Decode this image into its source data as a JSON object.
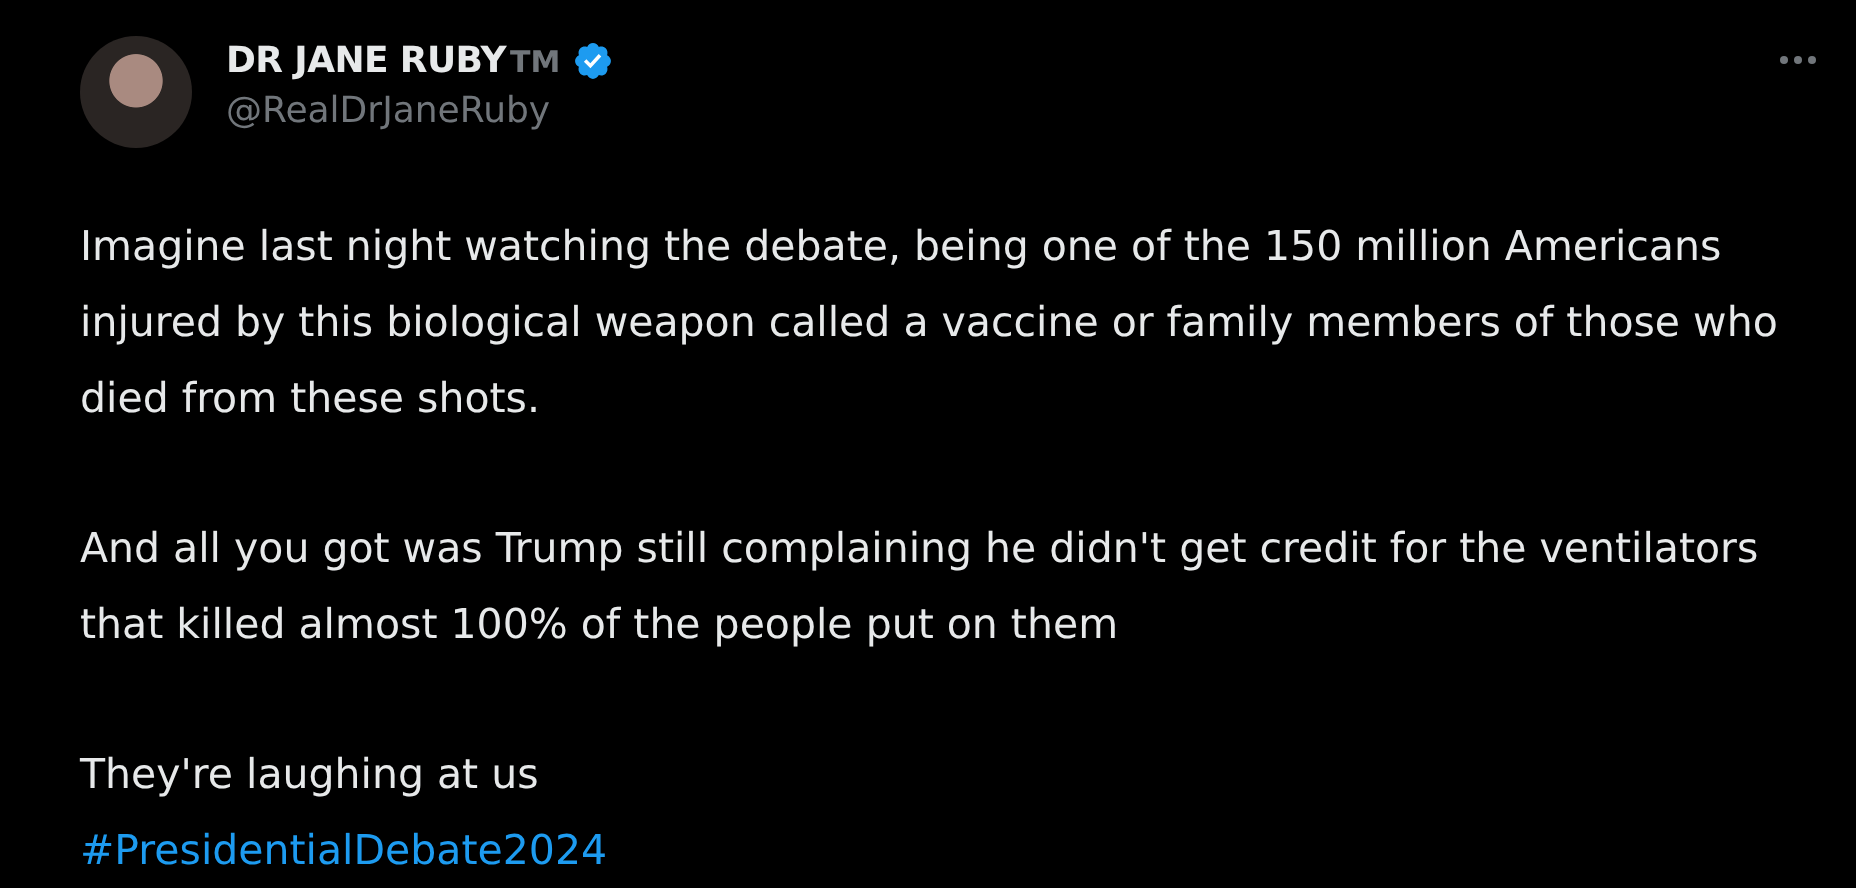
{
  "author": {
    "name": "DR JANE RUBY",
    "trademark": "TM",
    "verified": true,
    "handle": "@RealDrJaneRuby"
  },
  "paragraphs": [
    "Imagine last night watching the debate, being one of the 150 million Americans injured by this biological weapon called a vaccine or family members of those who died from these shots.",
    "And all you got was Trump still complaining he didn't get credit for the ventilators that killed almost 100% of the people put on them",
    "They're laughing at us"
  ],
  "hashtag": "#PresidentialDebate2024"
}
